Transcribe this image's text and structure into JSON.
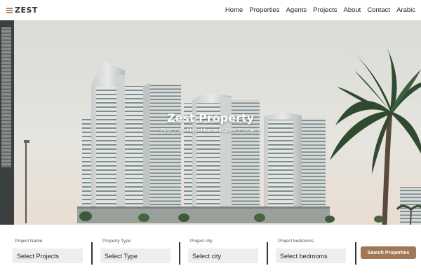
{
  "header": {
    "brand": "ZEST",
    "logo_icon": "zest-logo-icon",
    "nav": [
      "Home",
      "Properties",
      "Agents",
      "Projects",
      "About",
      "Contact",
      "Arabic"
    ]
  },
  "hero": {
    "title": "Zest Property",
    "subtitle": "Find Your Next Home In Zest Property"
  },
  "search": {
    "fields": [
      {
        "label": "Project Name",
        "value": "Select Projects"
      },
      {
        "label": "Property Type",
        "value": "Select Type"
      },
      {
        "label": "Project city",
        "value": "Select city"
      },
      {
        "label": "Project bedrooms",
        "value": "Select bedrooms"
      }
    ],
    "button": "Search Properties"
  },
  "colors": {
    "accent": "#a07857",
    "field_bg": "#eeeeee"
  }
}
